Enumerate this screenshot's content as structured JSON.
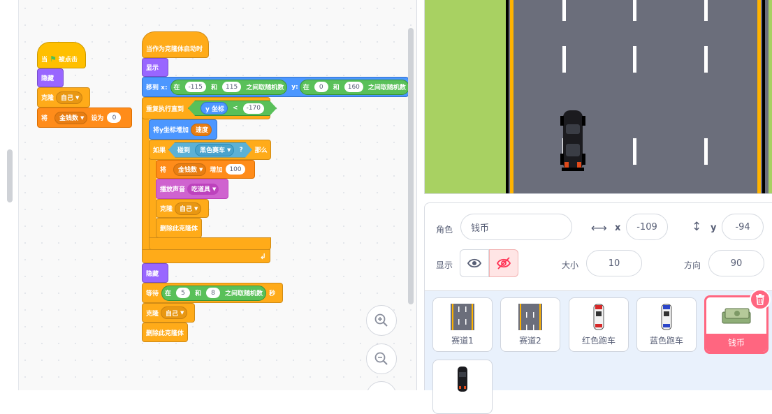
{
  "code": {
    "script1": {
      "hat_when": "当",
      "hat_clicked": "被点击",
      "hide": "隐藏",
      "clone": "克隆",
      "clone_target": "自己",
      "set_prefix": "将",
      "set_var": "金钱数",
      "set_mid": "设为",
      "set_value": "0"
    },
    "script2": {
      "hat": "当作为克隆体启动时",
      "show": "显示",
      "goto_prefix": "移到 x:",
      "rand_in": "在",
      "rand_and": "和",
      "rand_suffix": "之间取随机数",
      "x_min": "-115",
      "x_max": "115",
      "goto_y": "y:",
      "y_min": "0",
      "y_max": "160",
      "repeat_until": "重复执行直到",
      "y_reporter": "y 坐标",
      "lt": "<",
      "lt_value": "-170",
      "change_y": "将y坐标增加",
      "speed_var": "速度",
      "if_label": "如果",
      "touching": "碰到",
      "touching_target": "黑色赛车",
      "touching_q": "?",
      "then_label": "那么",
      "change_prefix": "将",
      "change_var": "金钱数",
      "change_mid": "增加",
      "change_value": "100",
      "play_sound": "播放声音",
      "sound_name": "吃道具",
      "clone": "克隆",
      "clone_target": "自己",
      "delete_clone": "删除此克隆体",
      "hide": "隐藏",
      "wait_prefix": "等待",
      "wait_min": "5",
      "wait_max": "8",
      "wait_suffix": "秒",
      "clone2": "克隆",
      "clone2_target": "自己",
      "delete_clone2": "删除此克隆体"
    }
  },
  "sprite_info": {
    "sprite_label": "角色",
    "sprite_name": "钱币",
    "x_label": "x",
    "x_value": "-109",
    "y_label": "y",
    "y_value": "-94",
    "show_label": "显示",
    "size_label": "大小",
    "size_value": "10",
    "direction_label": "方向",
    "direction_value": "90"
  },
  "sprites": [
    {
      "name": "赛道1"
    },
    {
      "name": "赛道2"
    },
    {
      "name": "红色跑车"
    },
    {
      "name": "蓝色跑车"
    },
    {
      "name": "钱币",
      "selected": true
    }
  ],
  "colors": {
    "events": "#ffbf00",
    "control": "#ffab19",
    "looks": "#9966ff",
    "motion": "#4c97ff",
    "variables": "#ff8c1a",
    "sound": "#cf63cf",
    "sensing": "#5cb1d6",
    "operators": "#59c059",
    "selected_sprite": "#ff6680"
  }
}
